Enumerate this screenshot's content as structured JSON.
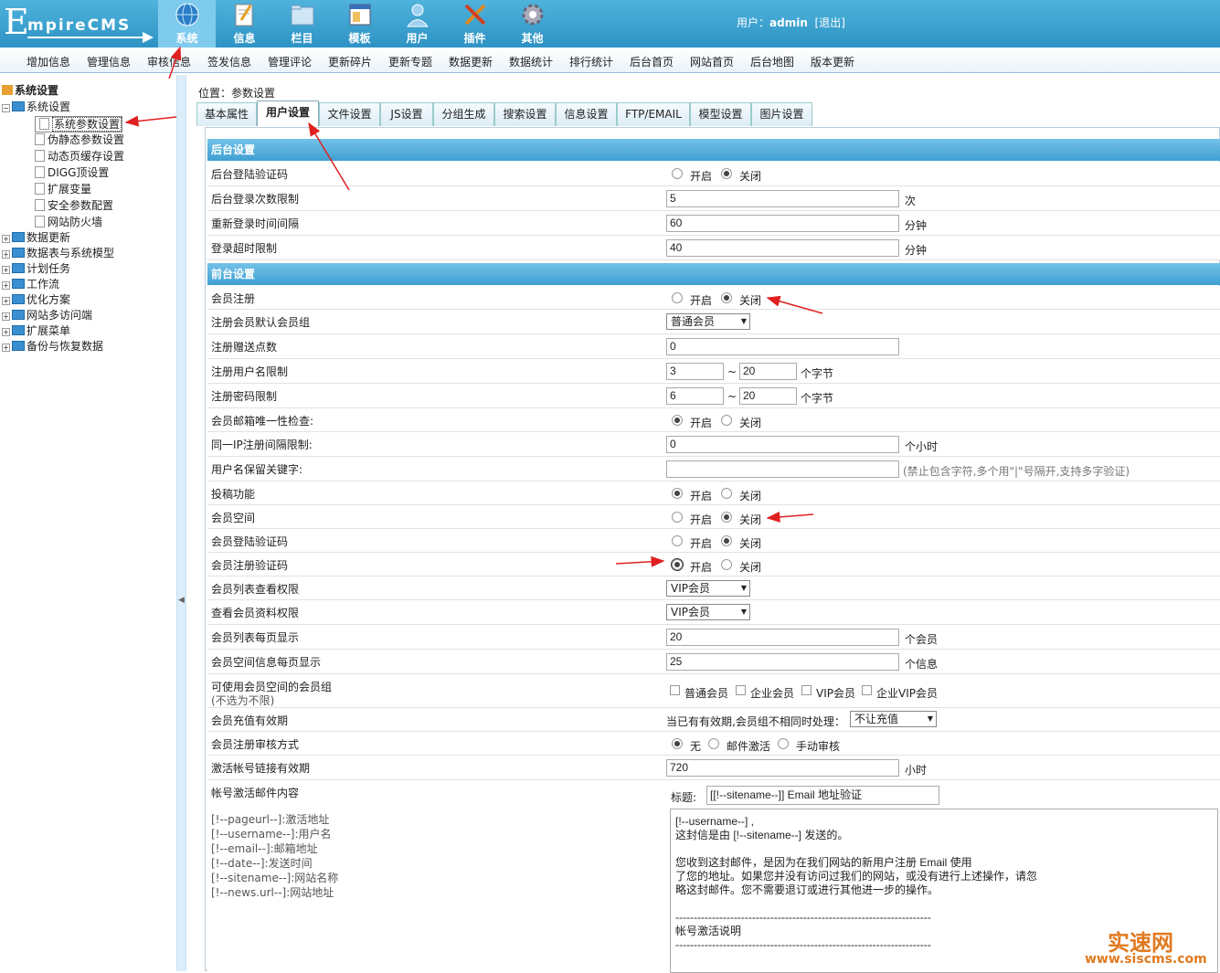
{
  "header": {
    "logo": {
      "big": "E",
      "rest": "mpireCMS"
    },
    "nav": [
      {
        "label": "系统",
        "icon": "globe-icon",
        "active": true
      },
      {
        "label": "信息",
        "icon": "document-edit-icon"
      },
      {
        "label": "栏目",
        "icon": "folder-icon"
      },
      {
        "label": "模板",
        "icon": "template-window-icon"
      },
      {
        "label": "用户",
        "icon": "user-icon"
      },
      {
        "label": "插件",
        "icon": "plugin-tools-icon"
      },
      {
        "label": "其他",
        "icon": "gear-icon"
      }
    ],
    "user": {
      "prefix": "用户：",
      "name": "admin",
      "logout": "[退出]"
    }
  },
  "menu": [
    "增加信息",
    "管理信息",
    "审核信息",
    "签发信息",
    "管理评论",
    "更新碎片",
    "更新专题",
    "数据更新",
    "数据统计",
    "排行统计",
    "后台首页",
    "网站首页",
    "后台地图",
    "版本更新"
  ],
  "tree": {
    "root": "系统设置",
    "group": "系统设置",
    "children": [
      "系统参数设置",
      "伪静态参数设置",
      "动态页缓存设置",
      "DIGG顶设置",
      "扩展变量",
      "安全参数配置",
      "网站防火墙"
    ],
    "folders": [
      "数据更新",
      "数据表与系统模型",
      "计划任务",
      "工作流",
      "优化方案",
      "网站多访问端",
      "扩展菜单",
      "备份与恢复数据"
    ]
  },
  "location": {
    "label": "位置：",
    "page": "参数设置"
  },
  "tabs": [
    "基本属性",
    "用户设置",
    "文件设置",
    "JS设置",
    "分组生成",
    "搜索设置",
    "信息设置",
    "FTP/EMAIL",
    "模型设置",
    "图片设置"
  ],
  "sections": {
    "backend": "后台设置",
    "frontend": "前台设置"
  },
  "radio_labels": {
    "on": "开启",
    "off": "关闭"
  },
  "fields": {
    "admin_captcha": {
      "label": "后台登陆验证码",
      "value": "关闭"
    },
    "admin_login_limit": {
      "label": "后台登录次数限制",
      "value": "5",
      "unit": "次"
    },
    "relogin_interval": {
      "label": "重新登录时间间隔",
      "value": "60",
      "unit": "分钟"
    },
    "login_timeout": {
      "label": "登录超时限制",
      "value": "40",
      "unit": "分钟"
    },
    "member_register": {
      "label": "会员注册",
      "value": "关闭"
    },
    "default_group": {
      "label": "注册会员默认会员组",
      "value": "普通会员"
    },
    "register_points": {
      "label": "注册赠送点数",
      "value": "0"
    },
    "username_limit": {
      "label": "注册用户名限制",
      "min": "3",
      "max": "20",
      "sep": "~",
      "unit": "个字节"
    },
    "password_limit": {
      "label": "注册密码限制",
      "min": "6",
      "max": "20",
      "sep": "~",
      "unit": "个字节"
    },
    "email_unique": {
      "label": "会员邮箱唯一性检查:",
      "value": "开启"
    },
    "ip_interval": {
      "label": "同一IP注册间隔限制:",
      "value": "0",
      "unit": "个小时"
    },
    "reserved_names": {
      "label": "用户名保留关键字:",
      "value": "",
      "hint": "(禁止包含字符,多个用\"|\"号隔开,支持多字验证)"
    },
    "contribute": {
      "label": "投稿功能",
      "value": "开启"
    },
    "member_space": {
      "label": "会员空间",
      "value": "关闭"
    },
    "member_login_captcha": {
      "label": "会员登陆验证码",
      "value": "关闭"
    },
    "member_register_captcha": {
      "label": "会员注册验证码",
      "value": "开启"
    },
    "list_permission": {
      "label": "会员列表查看权限",
      "value": "VIP会员"
    },
    "profile_permission": {
      "label": "查看会员资料权限",
      "value": "VIP会员"
    },
    "list_per_page": {
      "label": "会员列表每页显示",
      "value": "20",
      "unit": "个会员"
    },
    "space_per_page": {
      "label": "会员空间信息每页显示",
      "value": "25",
      "unit": "个信息"
    },
    "space_groups": {
      "label": "可使用会员空间的会员组",
      "sub": "(不选为不限)",
      "options": [
        "普通会员",
        "企业会员",
        "VIP会员",
        "企业VIP会员"
      ]
    },
    "recharge_validity": {
      "label": "会员充值有效期",
      "prefix": "当已有有效期,会员组不相同时处理：",
      "value": "不让充值"
    },
    "audit_mode": {
      "label": "会员注册审核方式",
      "options": [
        "无",
        "邮件激活",
        "手动审核"
      ],
      "value": "无"
    },
    "activation_validity": {
      "label": "激活帐号链接有效期",
      "value": "720",
      "unit": "小时"
    },
    "activation_mail": {
      "label": "帐号激活邮件内容",
      "vars": [
        "[!--pageurl--]:激活地址",
        "[!--username--]:用户名",
        "[!--email--]:邮箱地址",
        "[!--date--]:发送时间",
        "[!--sitename--]:网站名称",
        "[!--news.url--]:网站地址"
      ],
      "title_label": "标题:",
      "title_value": "[[!--sitename--]] Email 地址验证",
      "body": "[!--username--] ,\n这封信是由 [!--sitename--] 发送的。\n\n您收到这封邮件，是因为在我们网站的新用户注册 Email 使用\n了您的地址。如果您并没有访问过我们的网站，或没有进行上述操作，请忽\n略这封邮件。您不需要退订或进行其他进一步的操作。\n\n----------------------------------------------------------------------\n帐号激活说明\n----------------------------------------------------------------------"
    }
  },
  "watermark": {
    "cn": "实速网",
    "url": "www.siscms.com"
  },
  "colors": {
    "topbar": "#3aa3d3",
    "section": "#4aa8d8",
    "annotation": "#e02020"
  }
}
